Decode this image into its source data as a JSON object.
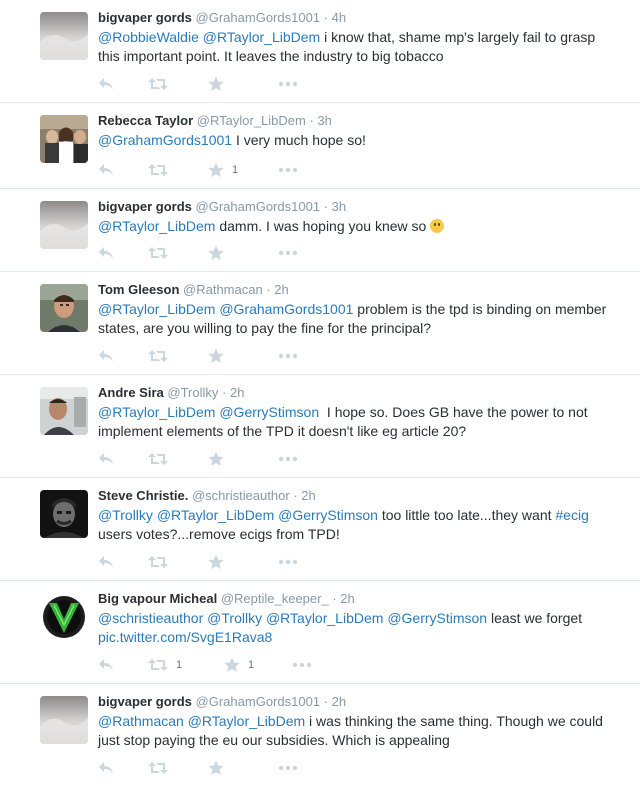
{
  "colors": {
    "link": "#2b7bb9",
    "muted": "#8899a6",
    "icon": "#ccd6dd",
    "divider": "#e1e8ed"
  },
  "icons": {
    "reply": "reply-icon",
    "retweet": "retweet-icon",
    "favorite": "favorite-star-icon",
    "more": "more-dots-icon"
  },
  "tweets": [
    {
      "name": "bigvaper gords",
      "handle": "@GrahamGords1001",
      "dot": "·",
      "time": "4h",
      "mentions": [
        "@RobbieWaldie",
        "@RTaylor_LibDem"
      ],
      "text": " i know that, shame mp's largely fail to grasp this important point. It leaves the industry to big tobacco",
      "retweets": "",
      "favorites": ""
    },
    {
      "name": "Rebecca Taylor",
      "handle": "@RTaylor_LibDem",
      "dot": "·",
      "time": "3h",
      "mentions": [
        "@GrahamGords1001"
      ],
      "text": " I very much hope so!",
      "retweets": "",
      "favorites": "1"
    },
    {
      "name": "bigvaper gords",
      "handle": "@GrahamGords1001",
      "dot": "·",
      "time": "3h",
      "mentions": [
        "@RTaylor_LibDem"
      ],
      "text": " damm. I was hoping you knew so ",
      "retweets": "",
      "favorites": ""
    },
    {
      "name": "Tom Gleeson",
      "handle": "@Rathmacan",
      "dot": "·",
      "time": "2h",
      "mentions": [
        "@RTaylor_LibDem",
        "@GrahamGords1001"
      ],
      "text": " problem is the tpd is binding on member states, are you willing to pay the fine for the principal?",
      "retweets": "",
      "favorites": ""
    },
    {
      "name": "Andre Sira",
      "handle": "@Trollky",
      "dot": "·",
      "time": "2h",
      "mentions": [
        "@RTaylor_LibDem",
        "@GerryStimson"
      ],
      "text": "  I hope so. Does GB have the power to not implement elements of the TPD it doesn't like eg article 20?",
      "retweets": "",
      "favorites": ""
    },
    {
      "name": "Steve Christie.",
      "handle": "@schristieauthor",
      "dot": "·",
      "time": "2h",
      "mentions": [
        "@Trollky",
        "@RTaylor_LibDem",
        "@GerryStimson"
      ],
      "text": " too little too late...they want ",
      "hashtag": "#ecig",
      "text_after": " users votes?...remove ecigs from TPD!",
      "retweets": "",
      "favorites": ""
    },
    {
      "name": "Big vapour Micheal",
      "handle": "@Reptile_keeper_",
      "dot": "·",
      "time": "2h",
      "mentions": [
        "@schristieauthor",
        "@Trollky",
        "@RTaylor_LibDem",
        "@GerryStimson"
      ],
      "text": " least we forget ",
      "link": "pic.twitter.com/SvgE1Rava8",
      "retweets": "1",
      "favorites": "1"
    },
    {
      "name": "bigvaper gords",
      "handle": "@GrahamGords1001",
      "dot": "·",
      "time": "2h",
      "mentions": [
        "@Rathmacan",
        "@RTaylor_LibDem"
      ],
      "text": " i was thinking the same thing. Though we could just stop paying the eu our subsidies. Which is appealing",
      "retweets": "",
      "favorites": ""
    }
  ]
}
